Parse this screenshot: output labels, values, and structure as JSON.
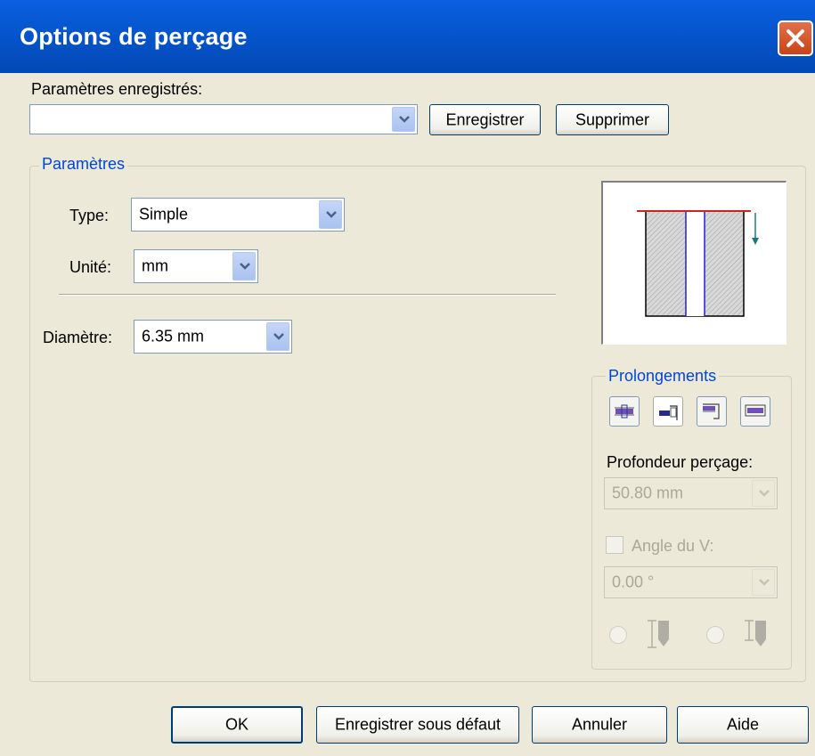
{
  "window": {
    "title": "Options de perçage"
  },
  "saved": {
    "label": "Paramètres enregistrés:",
    "value": "",
    "save_button": "Enregistrer",
    "delete_button": "Supprimer"
  },
  "params": {
    "legend": "Paramètres",
    "type_label": "Type:",
    "type_value": "Simple",
    "unit_label": "Unité:",
    "unit_value": "mm",
    "diameter_label": "Diamètre:",
    "diameter_value": "6.35 mm"
  },
  "extensions": {
    "legend": "Prolongements",
    "depth_label": "Profondeur perçage:",
    "depth_value": "50.80 mm",
    "angle_label": "Angle du V:",
    "angle_value": "0.00 °",
    "angle_checked": false
  },
  "footer": {
    "ok": "OK",
    "save_default": "Enregistrer sous défaut",
    "cancel": "Annuler",
    "help": "Aide"
  },
  "colors": {
    "title_bar": "#0453c8",
    "accent_blue": "#0046d5",
    "preview_top_line": "#d62020",
    "preview_hole": "#2222cc",
    "preview_arrow": "#1a7a7a"
  }
}
